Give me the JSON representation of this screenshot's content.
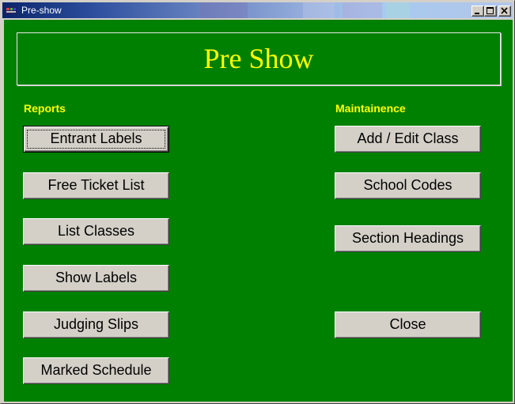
{
  "window": {
    "title": "Pre-show",
    "title_bar_color": "#0a246a",
    "client_background": "#008000",
    "accent_text_color": "#ffff00"
  },
  "header": {
    "title": "Pre Show"
  },
  "reports": {
    "label": "Reports",
    "buttons": {
      "entrant_labels": "Entrant Labels",
      "free_ticket_list": "Free Ticket List",
      "list_classes": "List Classes",
      "show_labels": "Show Labels",
      "judging_slips": "Judging Slips",
      "marked_schedule": "Marked Schedule"
    }
  },
  "maintenance": {
    "label": "Maintainence",
    "buttons": {
      "add_edit_class": "Add / Edit Class",
      "school_codes": "School Codes",
      "section_headings": "Section Headings",
      "close": "Close"
    }
  },
  "icons": {
    "app": "app-icon",
    "minimize": "minimize-icon",
    "maximize": "maximize-icon",
    "close": "close-icon"
  }
}
